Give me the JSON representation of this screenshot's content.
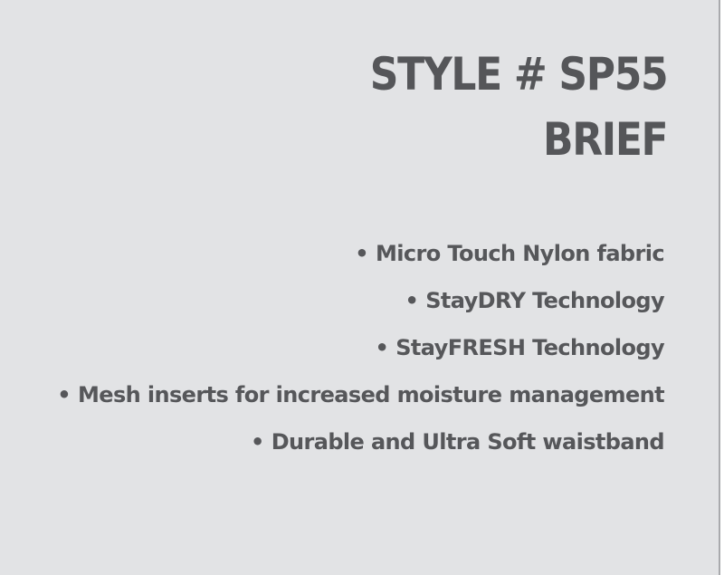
{
  "title": {
    "line1": "STYLE # SP55",
    "line2": "BRIEF"
  },
  "features": [
    "Micro Touch Nylon fabric",
    "StayDRY Technology",
    "StayFRESH Technology",
    "Mesh inserts for increased moisture management",
    "Durable and Ultra Soft waistband"
  ],
  "bullet": "•",
  "colors": {
    "background": "#e2e3e5",
    "text": "#555659",
    "edge": "#a9aaad"
  }
}
